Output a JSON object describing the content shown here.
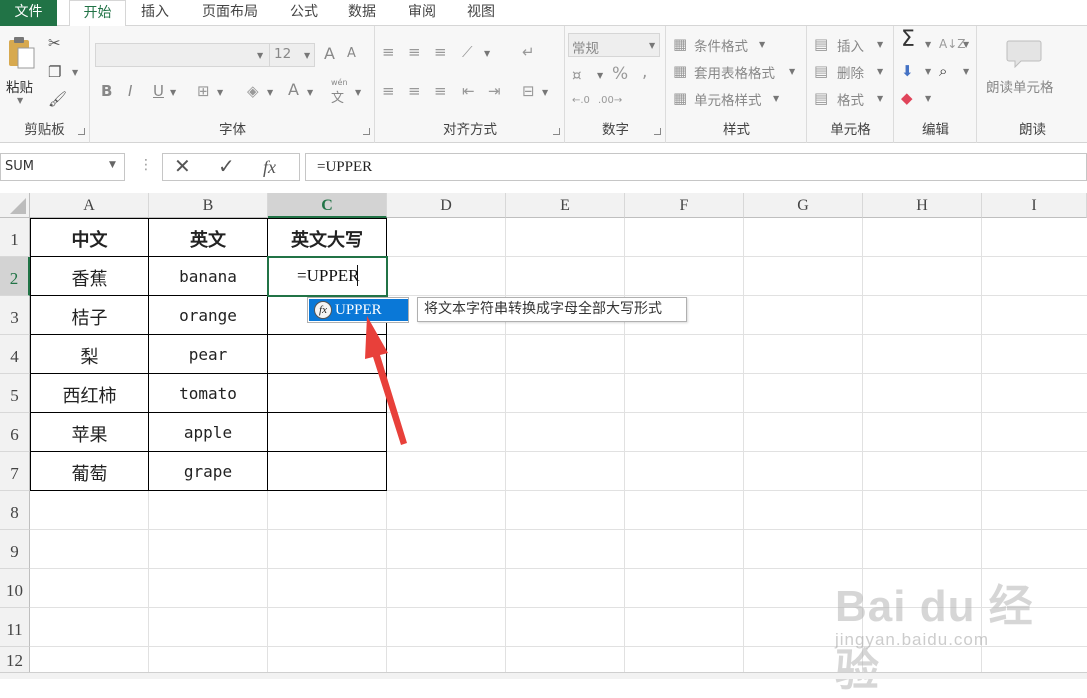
{
  "tabs": {
    "file": "文件",
    "home": "开始",
    "insert": "插入",
    "page_layout": "页面布局",
    "formulas": "公式",
    "data": "数据",
    "review": "审阅",
    "view": "视图"
  },
  "ribbon": {
    "clipboard": {
      "paste": "粘贴",
      "label": "剪贴板"
    },
    "font": {
      "size": "12",
      "label": "字体",
      "bold": "B",
      "italic": "I",
      "underline": "U",
      "grow": "A",
      "shrink": "A",
      "font_color": "A",
      "phonetic": "wén",
      "phonetic_char": "文"
    },
    "alignment": {
      "label": "对齐方式"
    },
    "number": {
      "format": "常规",
      "label": "数字",
      "percent": "%",
      "comma": ","
    },
    "styles": {
      "conditional": "条件格式",
      "table": "套用表格格式",
      "cell_styles": "单元格样式",
      "label": "样式"
    },
    "cells": {
      "insert": "插入",
      "delete": "删除",
      "format": "格式",
      "label": "单元格"
    },
    "editing": {
      "label": "编辑"
    },
    "read": {
      "button": "朗读单元格",
      "label": "朗读"
    }
  },
  "formula_bar": {
    "name_box": "SUM",
    "fx": "fx",
    "formula": "=UPPER"
  },
  "grid": {
    "columns": [
      "A",
      "B",
      "C",
      "D",
      "E",
      "F",
      "G",
      "H",
      "I"
    ],
    "rows": [
      "1",
      "2",
      "3",
      "4",
      "5",
      "6",
      "7",
      "8",
      "9",
      "10",
      "11",
      "12"
    ],
    "header_row": [
      "中文",
      "英文",
      "英文大写"
    ],
    "data_rows": [
      {
        "zh": "香蕉",
        "en": "banana"
      },
      {
        "zh": "桔子",
        "en": "orange"
      },
      {
        "zh": "梨",
        "en": "pear"
      },
      {
        "zh": "西红柿",
        "en": "tomato"
      },
      {
        "zh": "苹果",
        "en": "apple"
      },
      {
        "zh": "葡萄",
        "en": "grape"
      }
    ],
    "active_cell_text": "=UPPER"
  },
  "autocomplete": {
    "item": "UPPER",
    "icon": "fx",
    "tooltip": "将文本字符串转换成字母全部大写形式"
  },
  "watermark": {
    "logo": "Bai du 经验",
    "url": "jingyan.baidu.com"
  },
  "colors": {
    "accent": "#217346",
    "selection": "#0a78d7",
    "arrow": "#e8403a"
  }
}
